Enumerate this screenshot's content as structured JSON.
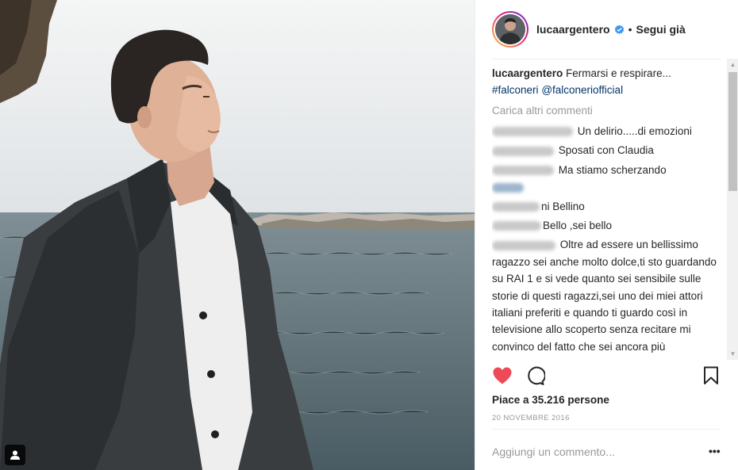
{
  "post": {
    "username": "lucaargentero",
    "verified_icon": "verified-badge-icon",
    "separator": "•",
    "follow_status": "Segui già"
  },
  "caption": {
    "username": "lucaargentero",
    "text": "Fermarsi e respirare...",
    "hashtag": "#falconeri",
    "mention": "@falconeriofficial"
  },
  "load_more": "Carica altri commenti",
  "comments": [
    {
      "text": "Un delirio.....di emozioni"
    },
    {
      "text": "Sposati con Claudia"
    },
    {
      "text": "Ma stiamo scherzando"
    },
    {
      "text": "ni Bellino"
    },
    {
      "text": "Bello ,sei bello"
    },
    {
      "text": "Oltre ad essere un bellissimo ragazzo sei anche molto dolce,ti sto guardando su RAI 1 e si vede quanto sei sensibile sulle storie di questi ragazzi,sei uno dei miei attori italiani preferiti e quando ti guardo così in televisione allo scoperto senza recitare mi convinco del fatto che sei ancora più straordinario di quello che si può vedere,ti faccio i miei"
    }
  ],
  "likes": "Piace a 35.216 persone",
  "date": "20 NOVEMBRE 2016",
  "add_comment_placeholder": "Aggiungi un commento...",
  "more_options": "•••",
  "colors": {
    "like_red": "#ed4956",
    "link_blue": "#003569",
    "muted_gray": "#999999"
  },
  "icons": [
    "heart-filled-icon",
    "comment-icon",
    "bookmark-icon",
    "user-tag-icon",
    "verified-badge-icon"
  ]
}
